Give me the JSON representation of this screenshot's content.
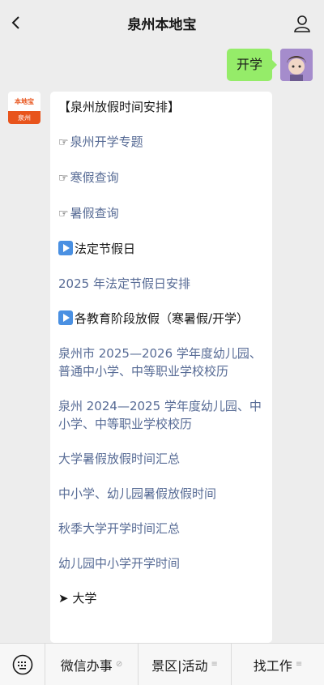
{
  "nav": {
    "title": "泉州本地宝",
    "back_icon": "chevron-left-icon",
    "profile_icon": "person-icon"
  },
  "user_message": {
    "text": "开学"
  },
  "bot": {
    "avatar_top": "本地宝",
    "avatar_bottom": "泉州"
  },
  "reply": {
    "lines": [
      {
        "text": "【泉州放假时间安排】",
        "kind": "dark"
      },
      {
        "text": "泉州开学专题",
        "kind": "link",
        "icon": "☞"
      },
      {
        "text": "寒假查询",
        "kind": "link",
        "icon": "☞"
      },
      {
        "text": "暑假查询",
        "kind": "link",
        "icon": "☞"
      },
      {
        "text": "法定节假日",
        "kind": "dark",
        "icon": "play"
      },
      {
        "text": "2025 年法定节假日安排",
        "kind": "link"
      },
      {
        "text": "各教育阶段放假（寒暑假/开学）",
        "kind": "dark",
        "icon": "play"
      },
      {
        "text": "泉州市 2025—2026 学年度幼儿园、普通中小学、中等职业学校校历",
        "kind": "link"
      },
      {
        "text": "泉州 2024—2025 学年度幼儿园、中小学、中等职业学校校历",
        "kind": "link"
      },
      {
        "text": "大学暑假放假时间汇总",
        "kind": "link"
      },
      {
        "text": "中小学、幼儿园暑假放假时间",
        "kind": "link"
      },
      {
        "text": "秋季大学开学时间汇总",
        "kind": "link"
      },
      {
        "text": "幼儿园中小学开学时间",
        "kind": "link"
      },
      {
        "text": "➤ 大学",
        "kind": "dark"
      }
    ]
  },
  "bottom_menu": {
    "keyboard_icon": "keyboard-icon",
    "items": [
      {
        "label": "微信办事",
        "sub_icon": "link-icon"
      },
      {
        "label": "景区|活动",
        "sub_icon": "menu-icon"
      },
      {
        "label": "找工作",
        "sub_icon": "menu-icon"
      }
    ]
  },
  "colors": {
    "background": "#ededed",
    "bubble_green": "#95ec69",
    "link": "#576b95",
    "accent": "#e8541c"
  }
}
